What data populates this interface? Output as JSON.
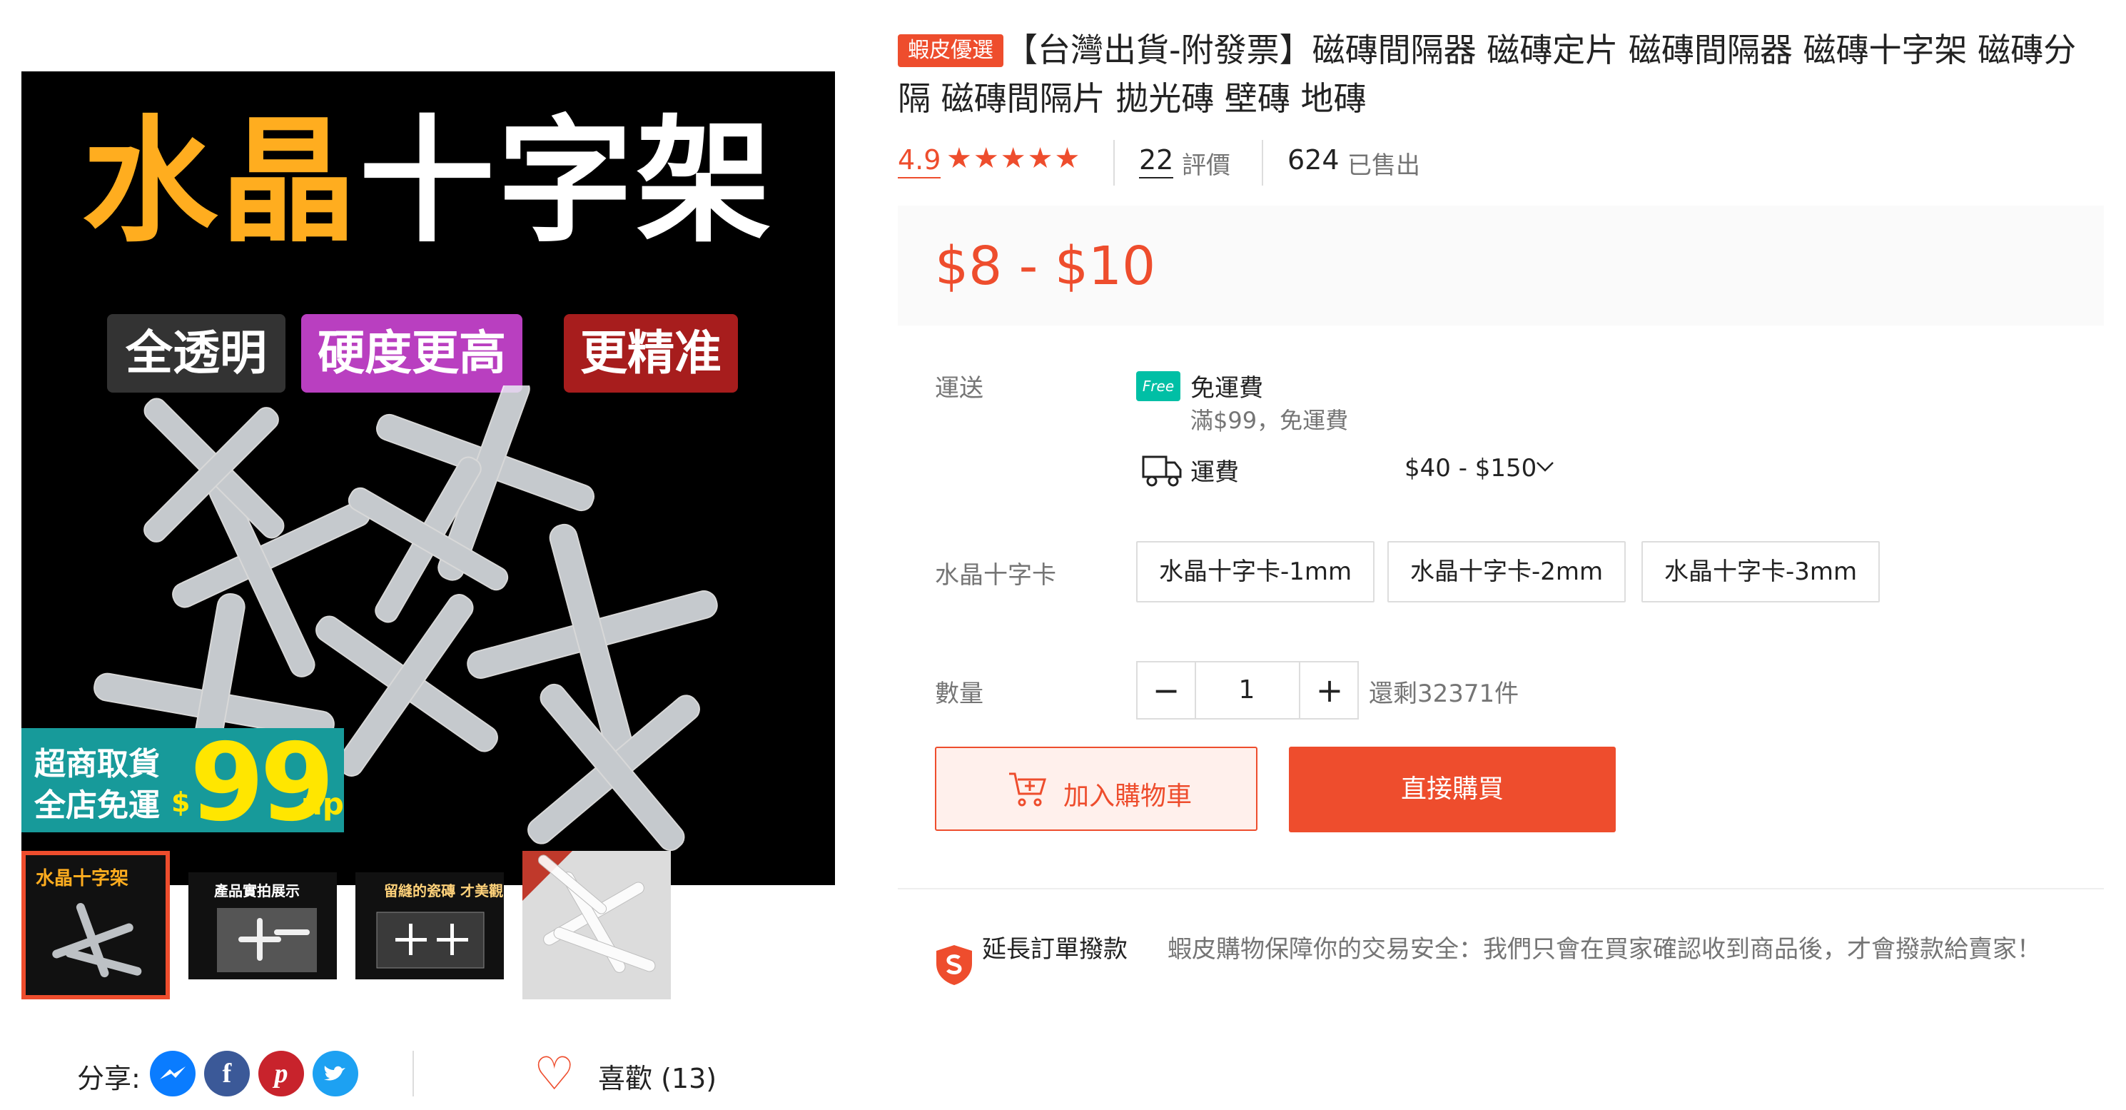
{
  "gallery": {
    "main_image": {
      "title_orange": "水晶",
      "title_white": "十字架",
      "tags": [
        {
          "label": "全透明",
          "color": "#333333"
        },
        {
          "label": "硬度更高",
          "color": "#b93fc0"
        },
        {
          "label": "更精准",
          "color": "#a71d1d"
        }
      ],
      "promo": {
        "line1": "超商取貨",
        "line2": "全店免運",
        "currency": "$",
        "amount": "99",
        "suffix": "up"
      }
    },
    "thumbnails": [
      {
        "caption": "水晶十字架",
        "active": true
      },
      {
        "caption": "產品實拍展示",
        "active": false
      },
      {
        "caption": "留縫的瓷磚 才美觀",
        "active": false
      },
      {
        "caption": "",
        "active": false
      }
    ]
  },
  "share": {
    "label": "分享:",
    "icons": [
      "messenger-icon",
      "facebook-icon",
      "pinterest-icon",
      "twitter-icon"
    ]
  },
  "like": {
    "label": "喜歡 (13)"
  },
  "product": {
    "badge": "蝦皮優選",
    "title": "【台灣出貨-附發票】磁磚間隔器 磁磚定片 磁磚間隔器 磁磚十字架 磁磚分隔 磁磚間隔片 拋光磚 壁磚 地磚",
    "rating": "4.9",
    "stars": "★★★★★",
    "review_count": "22",
    "review_label": "評價",
    "sold_count": "624",
    "sold_label": "已售出",
    "price": "$8 - $10"
  },
  "shipping": {
    "label": "運送",
    "free_badge": "Free",
    "free_text": "免運費",
    "free_sub": "滿$99，免運費",
    "fee_label": "運費",
    "fee_value": "$40 - $150"
  },
  "variants": {
    "label": "水晶十字卡",
    "options": [
      "水晶十字卡-1mm",
      "水晶十字卡-2mm",
      "水晶十字卡-3mm"
    ]
  },
  "quantity": {
    "label": "數量",
    "minus": "−",
    "value": "1",
    "plus": "+",
    "stock": "還剩32371件"
  },
  "actions": {
    "add_to_cart": "加入購物車",
    "buy_now": "直接購買"
  },
  "guarantee": {
    "title": "延長訂單撥款",
    "text": "蝦皮購物保障你的交易安全：我們只會在買家確認收到商品後，才會撥款給賣家！"
  },
  "colors": {
    "accent": "#ee4d2d",
    "free_badge": "#00bfa5",
    "promo_bg": "#179a9a",
    "promo_text": "#ffe600"
  }
}
